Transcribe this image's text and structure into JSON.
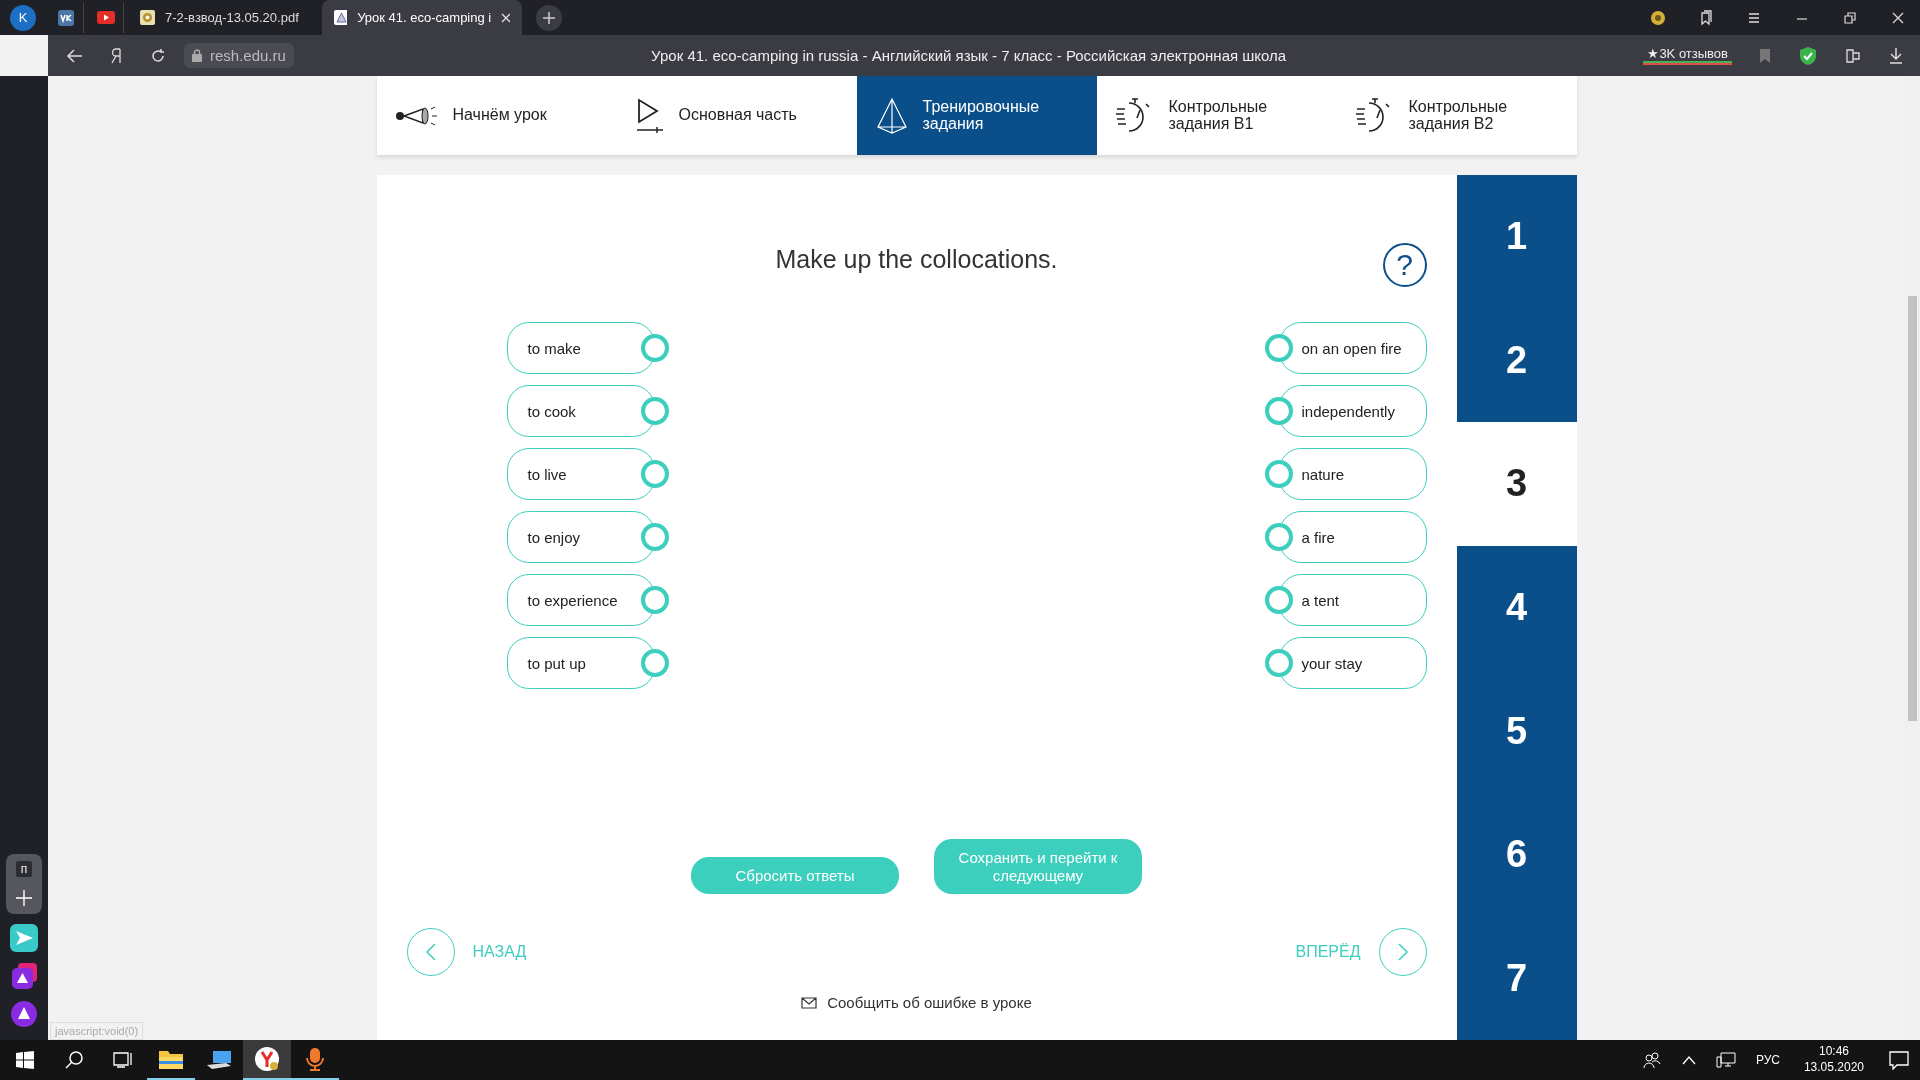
{
  "browser": {
    "tabs": [
      {
        "kind": "profile",
        "label": "K",
        "selected": false
      },
      {
        "kind": "vk",
        "selected": false
      },
      {
        "kind": "youtube",
        "selected": false
      },
      {
        "kind": "pdf",
        "label": "7-2-взвод-13.05.20.pdf",
        "selected": false
      },
      {
        "kind": "lesson",
        "label": "Урок 41. eco-camping i",
        "selected": true
      }
    ],
    "url": "resh.edu.ru",
    "page_title": "Урок 41. eco-camping in russia - Английский язык - 7 класс - Российская электронная школа",
    "reviews": "★3K отзывов",
    "status_url": "javascript:void(0)",
    "panel_tile": "п"
  },
  "lesson_nav": [
    {
      "kind": "megaphone",
      "label": "Начнём урок",
      "selected": false
    },
    {
      "kind": "play",
      "label": "Основная часть",
      "selected": false
    },
    {
      "kind": "pyramid",
      "label": "Тренировочные задания",
      "selected": true
    },
    {
      "kind": "timer",
      "label": "Контрольные задания В1",
      "selected": false
    },
    {
      "kind": "timer",
      "label": "Контрольные задания В2",
      "selected": false
    }
  ],
  "task": {
    "title": "Make up the collocations.",
    "help": "?",
    "left": [
      "to make",
      "to cook",
      "to live",
      "to enjoy",
      "to experience",
      "to put up"
    ],
    "right": [
      "on an open fire",
      "independently",
      "nature",
      "a fire",
      "a tent",
      "your stay"
    ],
    "reset_button": "Сбросить ответы",
    "save_button": "Сохранить и перейти к следующему",
    "back": "НАЗАД",
    "forward": "ВПЕРЁД",
    "report": "Сообщить об ошибке в уроке"
  },
  "task_numbers": [
    {
      "label": "1",
      "selected": false
    },
    {
      "label": "2",
      "selected": false
    },
    {
      "label": "3",
      "selected": true
    },
    {
      "label": "4",
      "selected": false
    },
    {
      "label": "5",
      "selected": false
    },
    {
      "label": "6",
      "selected": false
    },
    {
      "label": "7",
      "selected": false
    }
  ],
  "taskbar": {
    "language": "РУС",
    "time": "10:46",
    "date": "13.05.2020"
  }
}
